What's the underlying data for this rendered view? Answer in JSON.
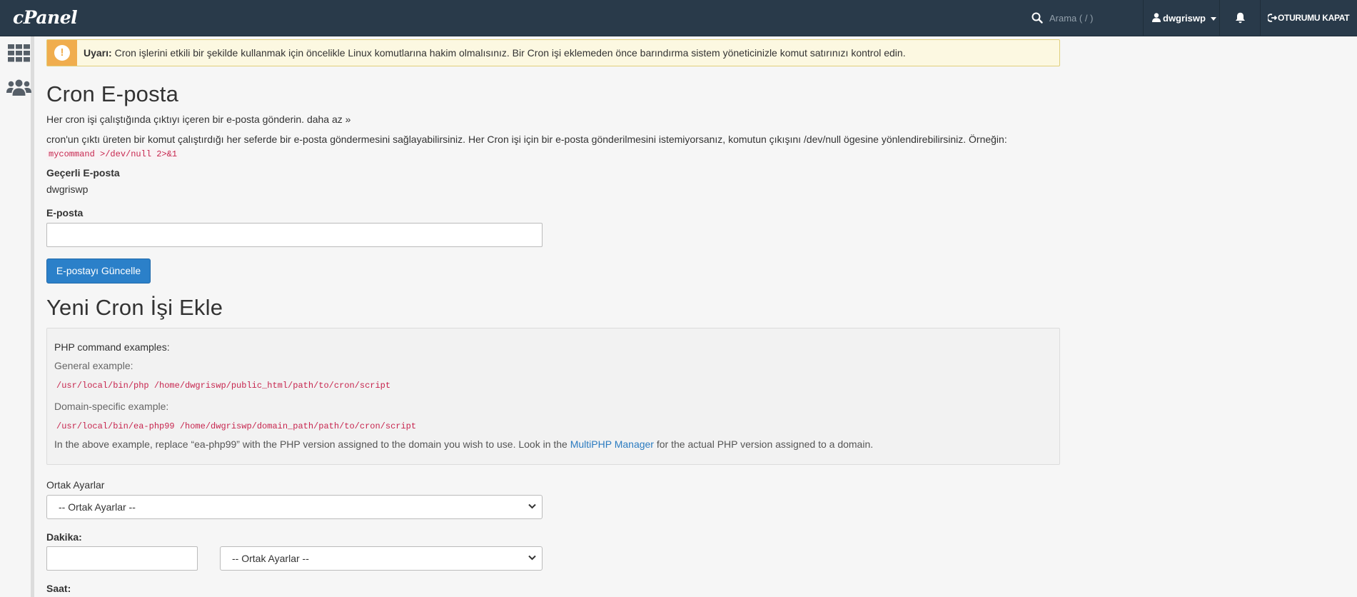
{
  "topbar": {
    "logo": "cPanel",
    "search_placeholder": "Arama ( / )",
    "username": "dwgriswp",
    "logout_label": "OTURUMU KAPAT"
  },
  "alert": {
    "prefix": "Uyarı:",
    "text": " Cron işlerini etkili bir şekilde kullanmak için öncelikle Linux komutlarına hakim olmalısınız. Bir Cron işi eklemeden önce barındırma sistem yöneticinizle komut satırınızı kontrol edin."
  },
  "cron_email": {
    "title": "Cron E-posta",
    "summary": "Her cron işi çalıştığında çıktıyı içeren bir e-posta gönderin.",
    "less_link": "daha az »",
    "description": "cron'un çıktı üreten bir komut çalıştırdığı her seferde bir e-posta göndermesini sağlayabilirsiniz. Her Cron işi için bir e-posta gönderilmesini istemiyorsanız, komutun çıkışını /dev/null ögesine yönlendirebilirsiniz. Örneğin:",
    "example_code": "mycommand >/dev/null 2>&1",
    "current_label": "Geçerli E-posta",
    "current_value": "dwgriswp",
    "email_label": "E-posta",
    "email_value": "",
    "update_button": "E-postayı Güncelle"
  },
  "new_cron": {
    "title": "Yeni Cron İşi Ekle",
    "php_heading": "PHP command examples:",
    "general_label": "General example:",
    "general_code": "/usr/local/bin/php /home/dwgriswp/public_html/path/to/cron/script",
    "domain_label": "Domain-specific example:",
    "domain_code": "/usr/local/bin/ea-php99 /home/dwgriswp/domain_path/path/to/cron/script",
    "note_before": "In the above example, replace “ea-php99” with the PHP version assigned to the domain you wish to use. Look in the ",
    "note_link": "MultiPHP Manager",
    "note_after": " for the actual PHP version assigned to a domain.",
    "common_label": "Ortak Ayarlar",
    "common_select": "-- Ortak Ayarlar --",
    "minute_label": "Dakika:",
    "minute_value": "",
    "minute_select": "-- Ortak Ayarlar --",
    "hour_label": "Saat:"
  }
}
